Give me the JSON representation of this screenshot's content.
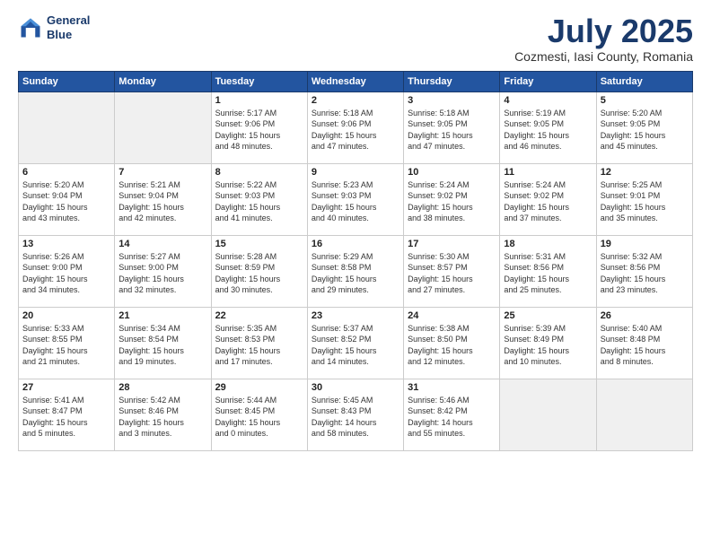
{
  "logo": {
    "line1": "General",
    "line2": "Blue"
  },
  "title": "July 2025",
  "subtitle": "Cozmesti, Iasi County, Romania",
  "weekdays": [
    "Sunday",
    "Monday",
    "Tuesday",
    "Wednesday",
    "Thursday",
    "Friday",
    "Saturday"
  ],
  "weeks": [
    [
      {
        "day": "",
        "info": "",
        "empty": true
      },
      {
        "day": "",
        "info": "",
        "empty": true
      },
      {
        "day": "1",
        "info": "Sunrise: 5:17 AM\nSunset: 9:06 PM\nDaylight: 15 hours\nand 48 minutes."
      },
      {
        "day": "2",
        "info": "Sunrise: 5:18 AM\nSunset: 9:06 PM\nDaylight: 15 hours\nand 47 minutes."
      },
      {
        "day": "3",
        "info": "Sunrise: 5:18 AM\nSunset: 9:05 PM\nDaylight: 15 hours\nand 47 minutes."
      },
      {
        "day": "4",
        "info": "Sunrise: 5:19 AM\nSunset: 9:05 PM\nDaylight: 15 hours\nand 46 minutes."
      },
      {
        "day": "5",
        "info": "Sunrise: 5:20 AM\nSunset: 9:05 PM\nDaylight: 15 hours\nand 45 minutes."
      }
    ],
    [
      {
        "day": "6",
        "info": "Sunrise: 5:20 AM\nSunset: 9:04 PM\nDaylight: 15 hours\nand 43 minutes."
      },
      {
        "day": "7",
        "info": "Sunrise: 5:21 AM\nSunset: 9:04 PM\nDaylight: 15 hours\nand 42 minutes."
      },
      {
        "day": "8",
        "info": "Sunrise: 5:22 AM\nSunset: 9:03 PM\nDaylight: 15 hours\nand 41 minutes."
      },
      {
        "day": "9",
        "info": "Sunrise: 5:23 AM\nSunset: 9:03 PM\nDaylight: 15 hours\nand 40 minutes."
      },
      {
        "day": "10",
        "info": "Sunrise: 5:24 AM\nSunset: 9:02 PM\nDaylight: 15 hours\nand 38 minutes."
      },
      {
        "day": "11",
        "info": "Sunrise: 5:24 AM\nSunset: 9:02 PM\nDaylight: 15 hours\nand 37 minutes."
      },
      {
        "day": "12",
        "info": "Sunrise: 5:25 AM\nSunset: 9:01 PM\nDaylight: 15 hours\nand 35 minutes."
      }
    ],
    [
      {
        "day": "13",
        "info": "Sunrise: 5:26 AM\nSunset: 9:00 PM\nDaylight: 15 hours\nand 34 minutes."
      },
      {
        "day": "14",
        "info": "Sunrise: 5:27 AM\nSunset: 9:00 PM\nDaylight: 15 hours\nand 32 minutes."
      },
      {
        "day": "15",
        "info": "Sunrise: 5:28 AM\nSunset: 8:59 PM\nDaylight: 15 hours\nand 30 minutes."
      },
      {
        "day": "16",
        "info": "Sunrise: 5:29 AM\nSunset: 8:58 PM\nDaylight: 15 hours\nand 29 minutes."
      },
      {
        "day": "17",
        "info": "Sunrise: 5:30 AM\nSunset: 8:57 PM\nDaylight: 15 hours\nand 27 minutes."
      },
      {
        "day": "18",
        "info": "Sunrise: 5:31 AM\nSunset: 8:56 PM\nDaylight: 15 hours\nand 25 minutes."
      },
      {
        "day": "19",
        "info": "Sunrise: 5:32 AM\nSunset: 8:56 PM\nDaylight: 15 hours\nand 23 minutes."
      }
    ],
    [
      {
        "day": "20",
        "info": "Sunrise: 5:33 AM\nSunset: 8:55 PM\nDaylight: 15 hours\nand 21 minutes."
      },
      {
        "day": "21",
        "info": "Sunrise: 5:34 AM\nSunset: 8:54 PM\nDaylight: 15 hours\nand 19 minutes."
      },
      {
        "day": "22",
        "info": "Sunrise: 5:35 AM\nSunset: 8:53 PM\nDaylight: 15 hours\nand 17 minutes."
      },
      {
        "day": "23",
        "info": "Sunrise: 5:37 AM\nSunset: 8:52 PM\nDaylight: 15 hours\nand 14 minutes."
      },
      {
        "day": "24",
        "info": "Sunrise: 5:38 AM\nSunset: 8:50 PM\nDaylight: 15 hours\nand 12 minutes."
      },
      {
        "day": "25",
        "info": "Sunrise: 5:39 AM\nSunset: 8:49 PM\nDaylight: 15 hours\nand 10 minutes."
      },
      {
        "day": "26",
        "info": "Sunrise: 5:40 AM\nSunset: 8:48 PM\nDaylight: 15 hours\nand 8 minutes."
      }
    ],
    [
      {
        "day": "27",
        "info": "Sunrise: 5:41 AM\nSunset: 8:47 PM\nDaylight: 15 hours\nand 5 minutes."
      },
      {
        "day": "28",
        "info": "Sunrise: 5:42 AM\nSunset: 8:46 PM\nDaylight: 15 hours\nand 3 minutes."
      },
      {
        "day": "29",
        "info": "Sunrise: 5:44 AM\nSunset: 8:45 PM\nDaylight: 15 hours\nand 0 minutes."
      },
      {
        "day": "30",
        "info": "Sunrise: 5:45 AM\nSunset: 8:43 PM\nDaylight: 14 hours\nand 58 minutes."
      },
      {
        "day": "31",
        "info": "Sunrise: 5:46 AM\nSunset: 8:42 PM\nDaylight: 14 hours\nand 55 minutes."
      },
      {
        "day": "",
        "info": "",
        "empty": true
      },
      {
        "day": "",
        "info": "",
        "empty": true
      }
    ]
  ]
}
